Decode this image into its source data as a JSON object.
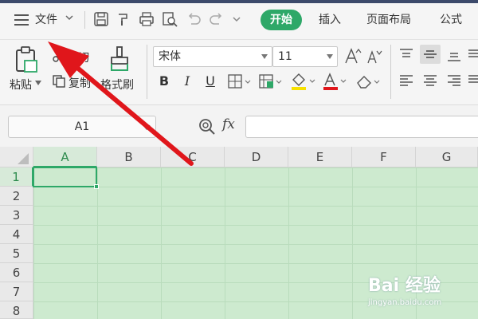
{
  "menubar": {
    "file_label": "文件",
    "tabs": [
      {
        "label": "开始",
        "active": true
      },
      {
        "label": "插入",
        "active": false
      },
      {
        "label": "页面布局",
        "active": false
      },
      {
        "label": "公式",
        "active": false
      }
    ],
    "quick_access_icons": [
      "save-icon",
      "format-painter-icon",
      "print-icon",
      "print-preview-icon",
      "undo-icon",
      "redo-icon",
      "more-icon"
    ]
  },
  "ribbon": {
    "paste_label": "粘贴",
    "cut_label": "剪切",
    "copy_label": "复制",
    "format_painter_label": "格式刷",
    "font_name": "宋体",
    "font_size": "11",
    "bold": "B",
    "italic": "I",
    "underline": "U"
  },
  "formula_bar": {
    "name_box": "A1",
    "fx_label": "fx",
    "formula_value": ""
  },
  "sheet": {
    "columns": [
      "A",
      "B",
      "C",
      "D",
      "E",
      "F",
      "G"
    ],
    "rows": [
      "1",
      "2",
      "3",
      "4",
      "5",
      "6",
      "7",
      "8"
    ],
    "selected_column": "A",
    "selected_row": "1"
  },
  "watermark": {
    "logo": "Bai 经验",
    "url": "jingyan.baidu.com"
  },
  "colors": {
    "accent": "#2ea868",
    "sheet_bg": "#cdeacf",
    "arrow": "#e0161b"
  }
}
